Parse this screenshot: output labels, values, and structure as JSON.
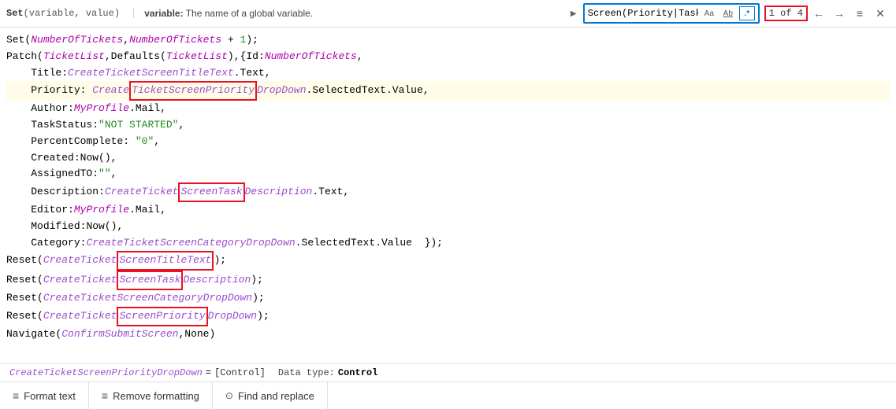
{
  "header": {
    "set_text": "Set(variable, value)",
    "set_keyword": "Set",
    "set_params": "(variable, value)",
    "divider": "|",
    "description_bold": "variable:",
    "description_text": " The name of a global variable."
  },
  "search": {
    "input_value": "Screen(Priority|Task)",
    "option_aa": "Aa",
    "option_ab": "Ab",
    "regex_symbol": ".*",
    "count": "1 of 4",
    "nav_prev": "←",
    "nav_next": "→",
    "nav_list": "≡",
    "nav_close": "✕"
  },
  "code": {
    "lines": [
      "Set(NumberOfTickets,NumberOfTickets + 1);",
      "Patch(TicketList,Defaults(TicketList),{Id:NumberOfTickets,",
      "    Title:CreateTicketScreenTitleText.Text,",
      "    Priority: CreateTicketScreenPriorityDropDown.SelectedText.Value,",
      "    Author:MyProfile.Mail,",
      "    TaskStatus:\"NOT STARTED\",",
      "    PercentComplete: \"0\",",
      "    Created:Now(),",
      "    AssignedTO:\"\",",
      "    Description:CreateTicketScreenTaskDescription.Text,",
      "    Editor:MyProfile.Mail,",
      "    Modified:Now(),",
      "    Category:CreateTicketScreenCategoryDropDown.SelectedText.Value  });",
      "Reset(CreateTicketScreenTitleText);",
      "Reset(CreateTicketScreenTaskDescription);",
      "Reset(CreateTicketScreenCategoryDropDown);",
      "Reset(CreateTicketScreenPriorityDropDown);",
      "Navigate(ConfirmSubmitScreen,None)"
    ]
  },
  "status": {
    "control_name": "CreateTicketScreenPriorityDropDown",
    "eq": "=",
    "bracket_open": "[",
    "control_label": "Control",
    "bracket_close": "]",
    "data_type_label": "Data type:",
    "data_type_value": "Control"
  },
  "toolbar": {
    "format_icon": "≡",
    "format_label": "Format text",
    "remove_icon": "≡",
    "remove_label": "Remove formatting",
    "find_icon": "○",
    "find_label": "Find and replace"
  }
}
